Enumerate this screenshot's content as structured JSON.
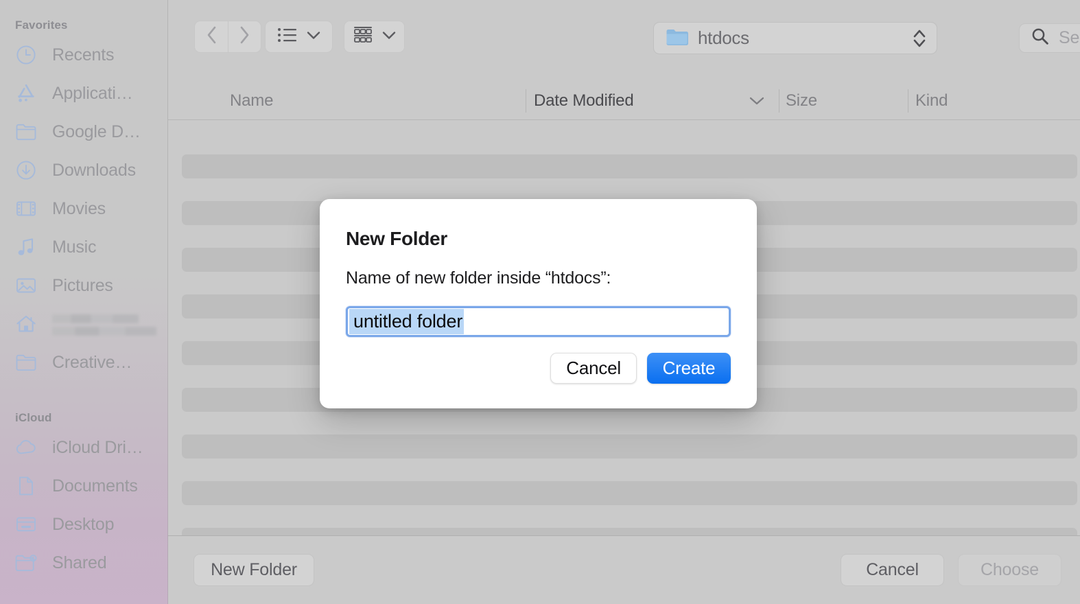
{
  "sidebar": {
    "sections": [
      {
        "title": "Favorites",
        "items": [
          {
            "label": "Recents",
            "icon": "clock-icon"
          },
          {
            "label": "Applicati…",
            "icon": "applications-icon"
          },
          {
            "label": "Google D…",
            "icon": "folder-icon"
          },
          {
            "label": "Downloads",
            "icon": "download-icon"
          },
          {
            "label": "Movies",
            "icon": "film-icon"
          },
          {
            "label": "Music",
            "icon": "music-note-icon"
          },
          {
            "label": "Pictures",
            "icon": "photo-icon"
          },
          {
            "label": "",
            "icon": "home-icon",
            "redacted": true
          },
          {
            "label": "Creative…",
            "icon": "folder-icon"
          }
        ]
      },
      {
        "title": "iCloud",
        "items": [
          {
            "label": "iCloud Dri…",
            "icon": "cloud-icon"
          },
          {
            "label": "Documents",
            "icon": "document-icon"
          },
          {
            "label": "Desktop",
            "icon": "desktop-icon"
          },
          {
            "label": "Shared",
            "icon": "shared-folder-icon"
          }
        ]
      }
    ]
  },
  "toolbar": {
    "back_icon": "chevron-left-icon",
    "forward_icon": "chevron-right-icon",
    "view_mode_icon": "list-view-icon",
    "view_mode_chevron": "chevron-down-icon",
    "group_by_icon": "grid-view-icon",
    "group_by_chevron": "chevron-down-icon",
    "path_folder_icon": "folder-icon",
    "path_label": "htdocs",
    "path_stepper_icon": "stepper-updown-icon",
    "search_icon": "search-icon",
    "search_placeholder": "Search",
    "search_value": ""
  },
  "columns": {
    "name": "Name",
    "date_modified": "Date Modified",
    "size": "Size",
    "kind": "Kind",
    "sort_chevron_icon": "chevron-down-icon",
    "sorted_by": "Date Modified"
  },
  "file_list": {
    "row_count": 9,
    "rows": []
  },
  "bottom_bar": {
    "new_folder_label": "New Folder",
    "cancel_label": "Cancel",
    "choose_label": "Choose",
    "choose_disabled": true
  },
  "modal": {
    "title": "New Folder",
    "message": "Name of new folder inside “htdocs”:",
    "field_value": "untitled folder",
    "field_placeholder": "",
    "field_selected": true,
    "cancel_label": "Cancel",
    "create_label": "Create"
  },
  "colors": {
    "accent_blue": "#0a6ff0",
    "focus_ring": "#7aa7e9",
    "selection_highlight": "#b9d7f7",
    "window_bg": "#cacaca",
    "sidebar_icon": "#a6bada",
    "sidebar_text": "#9a9a9e"
  }
}
